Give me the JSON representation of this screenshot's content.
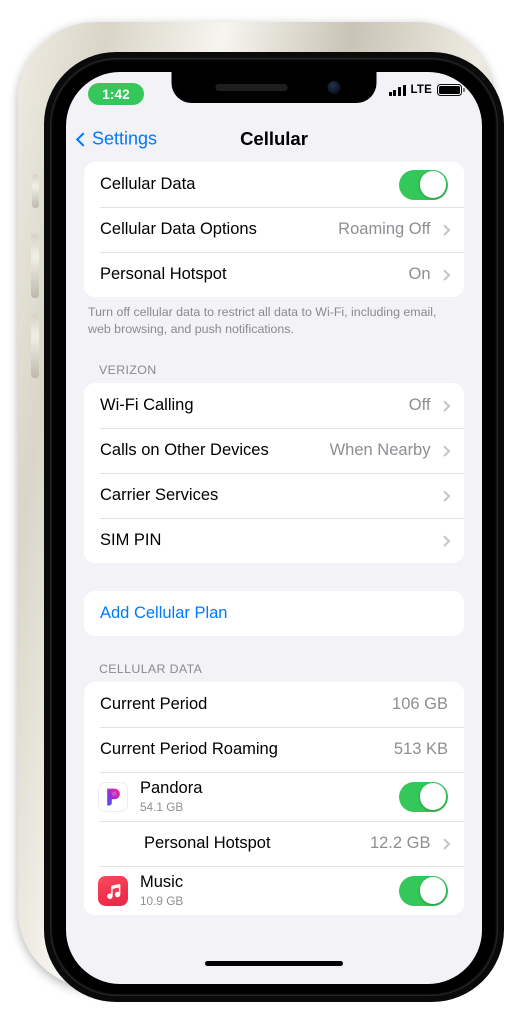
{
  "status_bar": {
    "time": "1:42",
    "time_pill_color": "#35c759",
    "network_type": "LTE",
    "signal_icon": "cellular-bars-icon",
    "battery_icon": "battery-full-icon"
  },
  "nav": {
    "back_label": "Settings",
    "back_icon": "chevron-left-icon",
    "title": "Cellular",
    "tint_color": "#007aff"
  },
  "groups": {
    "data_group": {
      "rows": [
        {
          "label": "Cellular Data",
          "control": "toggle",
          "toggle_on": true
        },
        {
          "label": "Cellular Data Options",
          "value": "Roaming Off",
          "control": "chevron"
        },
        {
          "label": "Personal Hotspot",
          "value": "On",
          "control": "chevron"
        }
      ],
      "footer": "Turn off cellular data to restrict all data to Wi-Fi, including email, web browsing, and push notifications."
    },
    "carrier_group": {
      "header": "VERIZON",
      "rows": [
        {
          "label": "Wi-Fi Calling",
          "value": "Off",
          "control": "chevron"
        },
        {
          "label": "Calls on Other Devices",
          "value": "When Nearby",
          "control": "chevron"
        },
        {
          "label": "Carrier Services",
          "value": "",
          "control": "chevron"
        },
        {
          "label": "SIM PIN",
          "value": "",
          "control": "chevron"
        }
      ]
    },
    "plan_group": {
      "rows": [
        {
          "label": "Add Cellular Plan",
          "value": "",
          "control": "none"
        }
      ]
    },
    "usage_group": {
      "header": "CELLULAR DATA",
      "rows": [
        {
          "label": "Current Period",
          "value": "106 GB",
          "control": "none"
        },
        {
          "label": "Current Period Roaming",
          "value": "513 KB",
          "control": "none"
        }
      ],
      "apps": [
        {
          "name": "Pandora",
          "usage": "54.1 GB",
          "icon": "pandora-app-icon",
          "toggle_on": true
        },
        {
          "name": "Music",
          "usage": "10.9 GB",
          "icon": "music-app-icon",
          "toggle_on": true
        }
      ],
      "hotspot_row": {
        "label": "Personal Hotspot",
        "value": "12.2 GB",
        "control": "chevron"
      }
    }
  },
  "colors": {
    "toggle_on": "#34c759",
    "tint": "#007aff",
    "screen_bg": "#f2f2f7",
    "secondary_text": "#8e8e93"
  }
}
